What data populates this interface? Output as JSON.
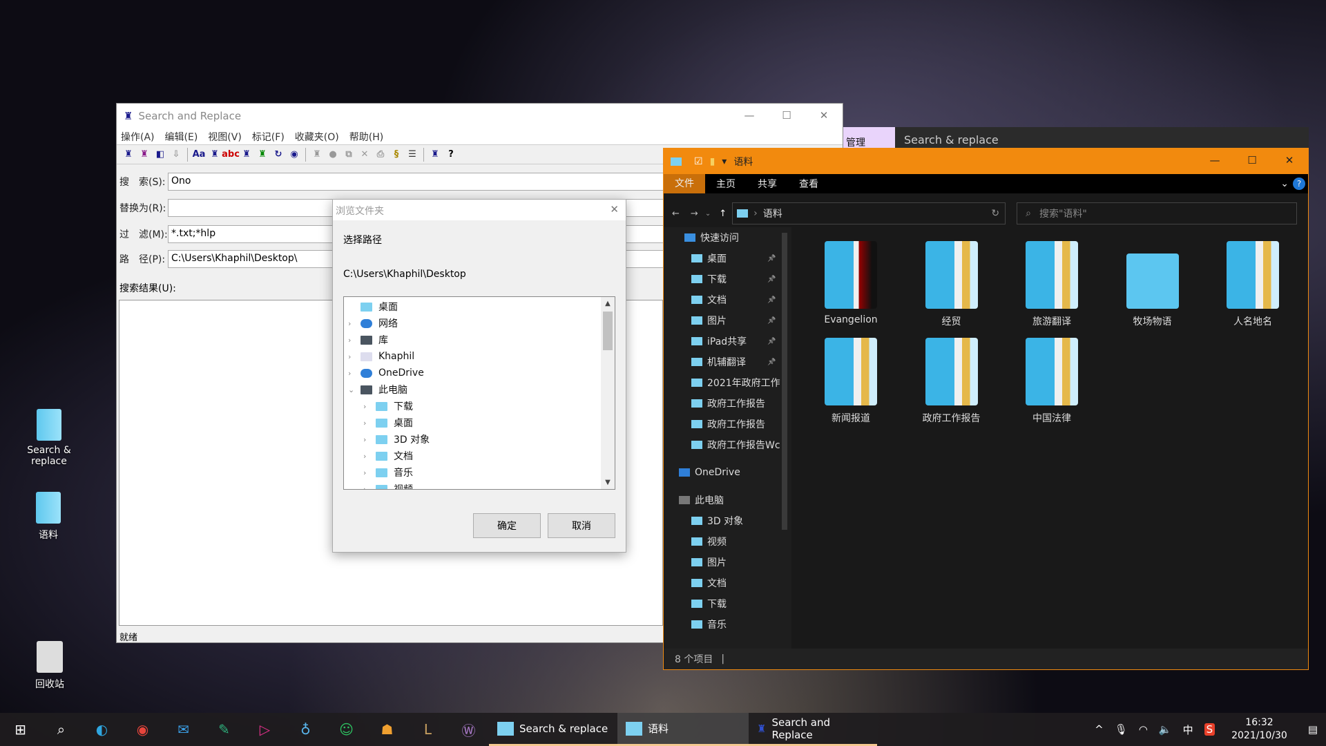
{
  "desktop": {
    "icons": [
      {
        "label": "Search &\nreplace"
      },
      {
        "label": "语料"
      },
      {
        "label": "回收站"
      }
    ]
  },
  "sr": {
    "title": "Search and Replace",
    "menu": [
      "操作(A)",
      "编辑(E)",
      "视图(V)",
      "标记(F)",
      "收藏夹(O)",
      "帮助(H)"
    ],
    "fields": {
      "search_label": "搜　索(S):",
      "search_value": "Ono",
      "replace_label": "替换为(R):",
      "replace_value": "",
      "filter_label": "过　滤(M):",
      "filter_value": "*.txt;*hlp",
      "path_label": "路　径(P):",
      "path_value": "C:\\Users\\Khaphil\\Desktop\\"
    },
    "results_label": "搜索结果(U):",
    "status": "就绪"
  },
  "dialog": {
    "title": "浏览文件夹",
    "prompt": "选择路径",
    "path": "C:\\Users\\Khaphil\\Desktop",
    "ok": "确定",
    "cancel": "取消",
    "tree": [
      {
        "label": "桌面",
        "level": 0,
        "icon": "desktop-folder"
      },
      {
        "label": "网络",
        "level": 1,
        "icon": "globe"
      },
      {
        "label": "库",
        "level": 1,
        "icon": "library"
      },
      {
        "label": "Khaphil",
        "level": 1,
        "icon": "user"
      },
      {
        "label": "OneDrive",
        "level": 1,
        "icon": "cloud"
      },
      {
        "label": "此电脑",
        "level": 1,
        "icon": "computer",
        "expanded": true
      },
      {
        "label": "下载",
        "level": 2,
        "icon": "folder"
      },
      {
        "label": "桌面",
        "level": 2,
        "icon": "folder"
      },
      {
        "label": "3D 对象",
        "level": 2,
        "icon": "folder"
      },
      {
        "label": "文档",
        "level": 2,
        "icon": "folder"
      },
      {
        "label": "音乐",
        "level": 2,
        "icon": "folder"
      },
      {
        "label": "视频",
        "level": 2,
        "icon": "folder"
      }
    ]
  },
  "back_window": {
    "tab": "管理",
    "title": "Search & replace"
  },
  "explorer": {
    "title": "语料",
    "tabs": [
      "文件",
      "主页",
      "共享",
      "查看"
    ],
    "breadcrumb": "语料",
    "search_placeholder": "搜索\"语料\"",
    "nav": [
      {
        "label": "快速访问",
        "type": "header"
      },
      {
        "label": "桌面",
        "pin": true
      },
      {
        "label": "下载",
        "pin": true
      },
      {
        "label": "文档",
        "pin": true
      },
      {
        "label": "图片",
        "pin": true
      },
      {
        "label": "iPad共享",
        "pin": true
      },
      {
        "label": "机辅翻译",
        "pin": true
      },
      {
        "label": "2021年政府工作"
      },
      {
        "label": "政府工作报告"
      },
      {
        "label": "政府工作报告"
      },
      {
        "label": "政府工作报告Wc"
      },
      {
        "label": "OneDrive",
        "type": "header"
      },
      {
        "label": "此电脑",
        "type": "header"
      },
      {
        "label": "3D 对象"
      },
      {
        "label": "视频"
      },
      {
        "label": "图片"
      },
      {
        "label": "文档"
      },
      {
        "label": "下载"
      },
      {
        "label": "音乐"
      }
    ],
    "items": [
      "Evangelion",
      "经贸",
      "旅游翻译",
      "牧场物语",
      "人名地名",
      "新闻报道",
      "政府工作报告",
      "中国法律"
    ],
    "status": "8 个项目",
    "accent": "#f28a0e"
  },
  "taskbar": {
    "apps": [
      {
        "label": "Search & replace"
      },
      {
        "label": "语料"
      },
      {
        "label": "Search and Replace"
      }
    ],
    "time": "16:32",
    "date": "2021/10/30",
    "ime": "中"
  }
}
